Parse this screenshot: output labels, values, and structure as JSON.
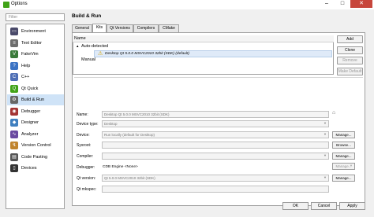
{
  "window": {
    "title": "Options",
    "minimize_glyph": "–",
    "maximize_glyph": "□",
    "close_glyph": "✕"
  },
  "sidebar": {
    "filter_placeholder": "Filter",
    "items": [
      {
        "label": "Environment",
        "icon": "monitor-icon",
        "color": "#4a4a6a",
        "glyph": "▭"
      },
      {
        "label": "Text Editor",
        "icon": "text-editor-icon",
        "color": "#6d6d6d",
        "glyph": "≡"
      },
      {
        "label": "FakeVim",
        "icon": "fakevim-icon",
        "color": "#3a7a3a",
        "glyph": "V"
      },
      {
        "label": "Help",
        "icon": "help-icon",
        "color": "#3b73c4",
        "glyph": "?"
      },
      {
        "label": "C++",
        "icon": "cpp-icon",
        "color": "#4f6fb5",
        "glyph": "C"
      },
      {
        "label": "Qt Quick",
        "icon": "qt-quick-icon",
        "color": "#41a317",
        "glyph": "Q"
      },
      {
        "label": "Build & Run",
        "icon": "build-run-icon",
        "color": "#666666",
        "glyph": "⚙"
      },
      {
        "label": "Debugger",
        "icon": "debugger-icon",
        "color": "#a33333",
        "glyph": "◉"
      },
      {
        "label": "Designer",
        "icon": "designer-icon",
        "color": "#3f7fbf",
        "glyph": "◆"
      },
      {
        "label": "Analyzer",
        "icon": "analyzer-icon",
        "color": "#6a4aa0",
        "glyph": "∿"
      },
      {
        "label": "Version Control",
        "icon": "version-control-icon",
        "color": "#c0842d",
        "glyph": "↯"
      },
      {
        "label": "Code Pasting",
        "icon": "code-pasting-icon",
        "color": "#555555",
        "glyph": "▤"
      },
      {
        "label": "Devices",
        "icon": "devices-icon",
        "color": "#333333",
        "glyph": "▯"
      }
    ],
    "active_index": 6
  },
  "page": {
    "heading": "Build & Run",
    "tabs": [
      "General",
      "Kits",
      "Qt Versions",
      "Compilers",
      "CMake"
    ],
    "active_tab": 1
  },
  "kits": {
    "column_header": "Name",
    "auto_detected_label": "Auto-detected",
    "kit_entry": "Desktop Qt 5.0.0 MSVC2010 32bit (SDK) (default)",
    "manual_label": "Manual",
    "buttons": {
      "add": "Add",
      "clone": "Clone",
      "remove": "Remove",
      "make_default": "Make Default"
    }
  },
  "form": {
    "name_label": "Name:",
    "name_value": "Desktop Qt 5.0.0 MSVC2010 32bit (SDK)",
    "device_type_label": "Device type:",
    "device_type_value": "Desktop",
    "device_label": "Device:",
    "device_value": "Run locally (default for Desktop)",
    "sysroot_label": "Sysroot:",
    "sysroot_value": "",
    "compiler_label": "Compiler:",
    "compiler_value": "",
    "debugger_label": "Debugger:",
    "debugger_value": "CDB Engine <None>",
    "qt_version_label": "Qt version:",
    "qt_version_value": "Qt 5.0.0 MSVC2010 32bit (SDK)",
    "qt_mkspec_label": "Qt mkspec:",
    "qt_mkspec_value": "",
    "manage_label": "Manage...",
    "browse_label": "Browse..."
  },
  "footer": {
    "ok": "OK",
    "cancel": "Cancel",
    "apply": "Apply"
  }
}
